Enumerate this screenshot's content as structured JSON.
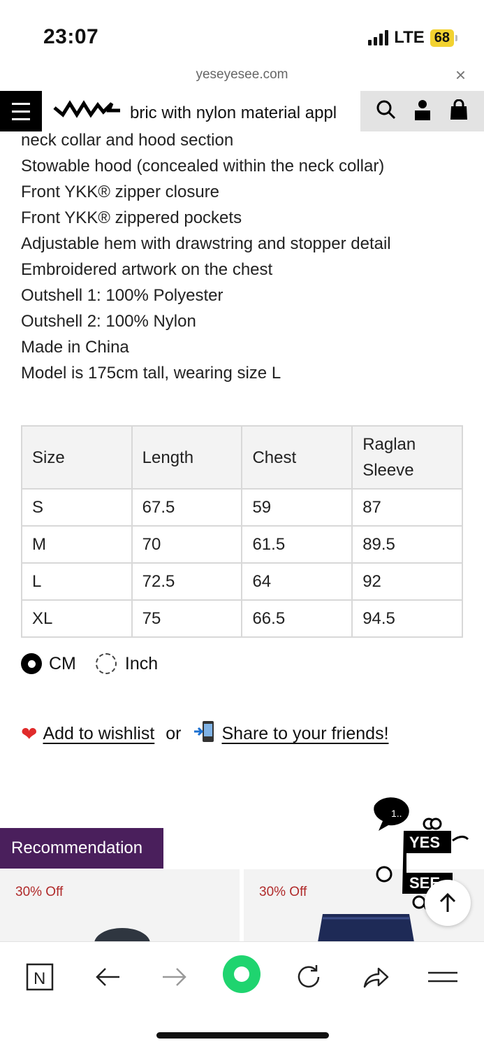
{
  "status_bar": {
    "time": "23:07",
    "network": "LTE",
    "battery": "68"
  },
  "browser": {
    "url": "yeseyesee.com",
    "close": "×"
  },
  "header": {
    "text": "bric with nylon material appl"
  },
  "description": [
    "neck collar and hood section",
    "Stowable hood (concealed within the neck collar)",
    "Front YKK® zipper closure",
    "Front YKK® zippered pockets",
    "Adjustable hem with drawstring and stopper detail",
    "Embroidered artwork on the chest",
    "Outshell 1: 100% Polyester",
    "Outshell 2: 100% Nylon",
    "Made in China",
    "Model is 175cm tall, wearing size L"
  ],
  "size_table": {
    "headers": [
      "Size",
      "Length",
      "Chest",
      "Raglan\nSleeve"
    ],
    "rows": [
      [
        "S",
        "67.5",
        "59",
        "87"
      ],
      [
        "M",
        "70",
        "61.5",
        "89.5"
      ],
      [
        "L",
        "72.5",
        "64",
        "92"
      ],
      [
        "XL",
        "75",
        "66.5",
        "94.5"
      ]
    ]
  },
  "units": {
    "cm": "CM",
    "inch": "Inch",
    "selected": "CM"
  },
  "actions": {
    "wishlist": "Add to wishlist",
    "or": "or",
    "share": "Share to your friends!"
  },
  "recommendation": {
    "label": "Recommendation",
    "cards": [
      {
        "discount": "30% Off"
      },
      {
        "discount": "30% Off"
      }
    ]
  },
  "mascot": {
    "bubble": "1.."
  },
  "toolbar": {
    "tab_letter": "N",
    "accent": "#1fd46f"
  }
}
